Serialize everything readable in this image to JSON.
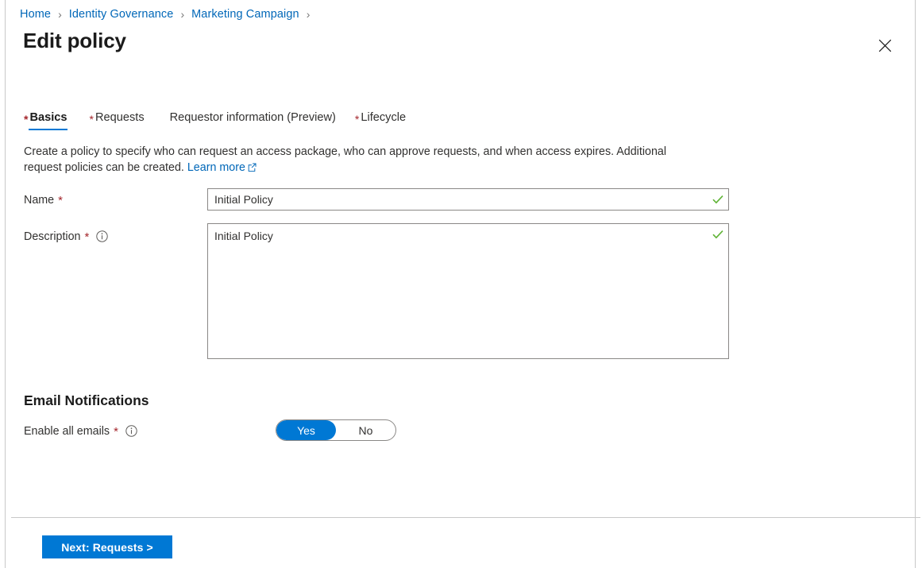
{
  "breadcrumb": {
    "separator": "›",
    "items": [
      {
        "label": "Home"
      },
      {
        "label": "Identity Governance"
      },
      {
        "label": "Marketing Campaign"
      }
    ],
    "trailing_separator": "›"
  },
  "header": {
    "title": "Edit policy",
    "close_icon": "close-icon",
    "close_glyph": "✕"
  },
  "tabs": [
    {
      "label": "Basics",
      "required": true,
      "required_marker": "*",
      "selected": true
    },
    {
      "label": "Requests",
      "required": true,
      "required_marker": "*",
      "selected": false
    },
    {
      "label": "Requestor information (Preview)",
      "required": false,
      "required_marker": "",
      "selected": false
    },
    {
      "label": "Lifecycle",
      "required": true,
      "required_marker": "*",
      "selected": false
    }
  ],
  "intro": {
    "text": "Create a policy to specify who can request an access package, who can approve requests, and when access expires. Additional request policies can be created.",
    "link_label": "Learn more",
    "link_icon": "external-link-icon"
  },
  "form": {
    "name": {
      "label": "Name",
      "required_marker": "*",
      "value": "Initial Policy",
      "placeholder": "",
      "validation_icon": "checkmark-icon"
    },
    "description": {
      "label": "Description",
      "required_marker": "*",
      "info_icon": "info-icon",
      "value": "Initial Policy",
      "placeholder": "",
      "validation_icon": "checkmark-icon"
    }
  },
  "email_notifications": {
    "section_title": "Email Notifications",
    "enable": {
      "label": "Enable all emails",
      "required_marker": "*",
      "info_icon": "info-icon",
      "on_label": "Yes",
      "off_label": "No",
      "value": "Yes"
    }
  },
  "footer": {
    "next_label": "Next: Requests >"
  },
  "colors": {
    "accent": "#0078d4",
    "link": "#0067b8",
    "required": "#a4262c",
    "valid": "#5fb335",
    "text": "#323130",
    "border": "#8a8886",
    "panel_border": "#c8c8c8"
  }
}
